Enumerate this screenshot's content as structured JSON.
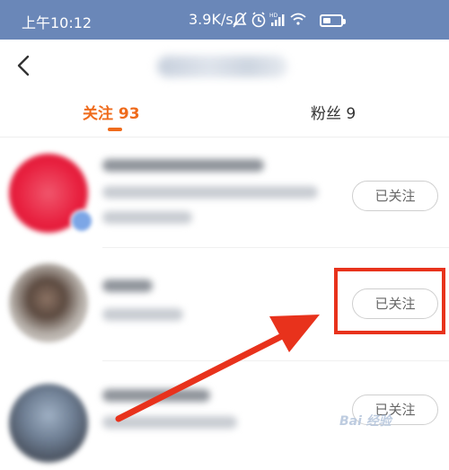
{
  "status_bar": {
    "time": "上午10:12",
    "net_speed": "3.9K/s",
    "battery_level": 0.45
  },
  "header": {
    "back_icon": "chevron-left-icon"
  },
  "tabs": [
    {
      "label": "关注 93",
      "active": true
    },
    {
      "label": "粉丝 9",
      "active": false
    }
  ],
  "list": [
    {
      "button_label": "已关注"
    },
    {
      "button_label": "已关注"
    },
    {
      "button_label": "已关注"
    }
  ],
  "colors": {
    "accent": "#ef6b1c",
    "status_bar_bg": "#6a87b8",
    "annotation_red": "#e8321c"
  },
  "watermark": "Bai 经验"
}
